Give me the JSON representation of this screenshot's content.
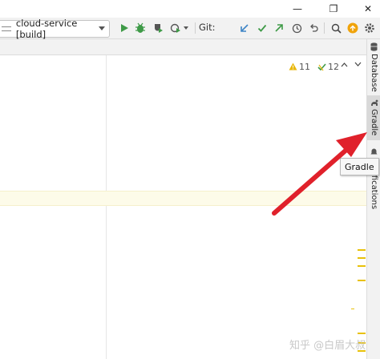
{
  "window": {
    "controls": [
      {
        "name": "minimize-button",
        "glyph": "—"
      },
      {
        "name": "maximize-button",
        "glyph": "❐"
      },
      {
        "name": "close-button",
        "glyph": "✕"
      }
    ]
  },
  "toolbar": {
    "run_config": "cloud-service [build]",
    "git_label": "Git:",
    "icons": [
      "run-icon",
      "debug-icon",
      "coverage-icon",
      "profile-icon",
      "git-update-icon",
      "git-commit-icon",
      "git-push-icon",
      "history-icon",
      "rollback-icon",
      "search-icon",
      "update-icon",
      "settings-icon"
    ],
    "colors": {
      "run": "#3e9a47",
      "git_blue": "#3d84c6",
      "git_green": "#3e9a47",
      "update_badge": "#f0a30a"
    }
  },
  "editor": {
    "warnings_count": "11",
    "weak_warnings_count": "12",
    "warning_color": "#e8b70a",
    "weak_warning_color": "#3e9a47"
  },
  "sidebar": {
    "tabs": [
      {
        "label": "Database",
        "icon": "database-icon"
      },
      {
        "label": "Gradle",
        "icon": "gradle-icon"
      },
      {
        "label": "ifications",
        "icon": "notifications-icon"
      }
    ]
  },
  "tooltip": {
    "text": "Gradle"
  },
  "annotation": {
    "arrow_color": "#e0212b"
  },
  "watermark": {
    "text": "知乎 @白眉大叔"
  }
}
